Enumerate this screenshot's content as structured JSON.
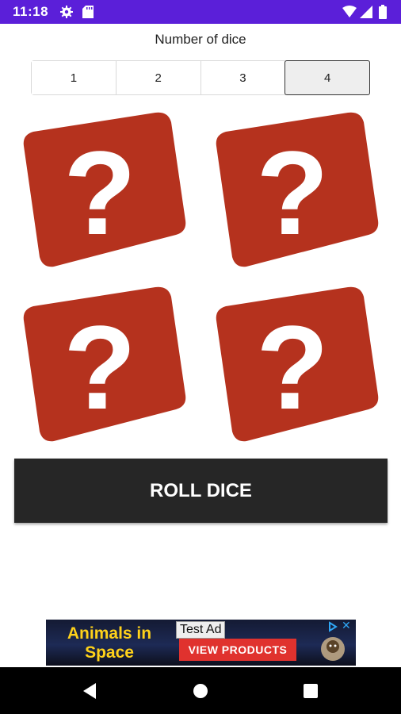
{
  "status_bar": {
    "time": "11:18",
    "icons": [
      "gear-icon",
      "sd-card-icon",
      "wifi-icon",
      "signal-icon",
      "battery-icon"
    ],
    "color": "#5b1fd9"
  },
  "dice_count": {
    "label": "Number of dice",
    "options": [
      "1",
      "2",
      "3",
      "4"
    ],
    "selected": "4"
  },
  "dice": {
    "faces": [
      "?",
      "?",
      "?",
      "?"
    ],
    "color": "#b5321e"
  },
  "roll_button": {
    "label": "ROLL DICE"
  },
  "ad": {
    "headline_line1": "Animals in",
    "headline_line2": "Space",
    "test_label": "Test Ad",
    "cta": "VIEW PRODUCTS",
    "close": "✕"
  },
  "nav_bar": {
    "icons": [
      "back-icon",
      "home-icon",
      "recent-apps-icon"
    ]
  }
}
